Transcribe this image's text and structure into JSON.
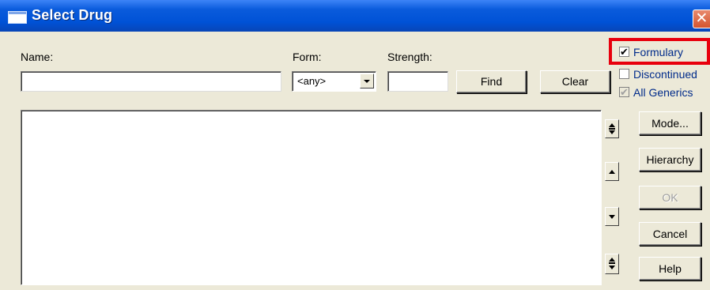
{
  "window": {
    "title": "Select Drug",
    "close_label": "✕"
  },
  "form": {
    "name_label": "Name:",
    "name_value": "",
    "form_label": "Form:",
    "form_value": "<any>",
    "strength_label": "Strength:",
    "strength_value": ""
  },
  "buttons": {
    "find": "Find",
    "clear": "Clear",
    "mode": "Mode...",
    "hierarchy": "Hierarchy",
    "ok": "OK",
    "cancel": "Cancel",
    "help": "Help"
  },
  "checkboxes": [
    {
      "label": "Formulary",
      "checked": true,
      "disabled": false
    },
    {
      "label": "Discontinued",
      "checked": false,
      "disabled": false
    },
    {
      "label": "All Generics",
      "checked": true,
      "disabled": true
    }
  ],
  "highlight_color": "#e8000d",
  "title_bar_color": "#0052d6",
  "results": []
}
